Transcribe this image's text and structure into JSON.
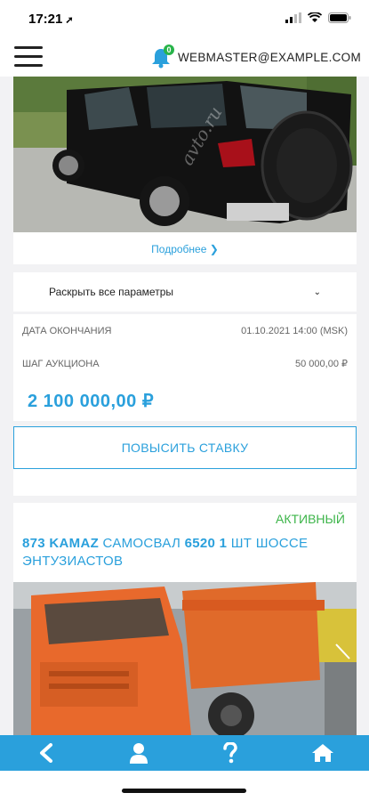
{
  "status_bar": {
    "time": "17:21",
    "location_glyph": "➚"
  },
  "header": {
    "email": "WEBMASTER@EXAMPLE.COM",
    "notification_count": "0"
  },
  "lot1": {
    "more_link": "Подробнее",
    "params_toggle": "Раскрыть все параметры",
    "end_date_label": "ДАТА ОКОНЧАНИЯ",
    "end_date_value": "01.10.2021 14:00 (MSK)",
    "step_label": "ШАГ АУКЦИОНА",
    "step_value": "50 000,00 ₽",
    "price": "2 100 000,00 ₽",
    "raise_button": "ПОВЫСИТЬ СТАВКУ",
    "watermark": "avto.ru"
  },
  "lot2": {
    "status": "АКТИВНЫЙ",
    "title_part1": "873 KAMAZ",
    "title_part2": "САМОСВАЛ",
    "title_part3": "6520 1",
    "title_part4": "ШТ ШОССЕ ЭНТУЗИАСТОВ"
  },
  "colors": {
    "accent": "#2aa0dc",
    "active": "#3db54a",
    "badge": "#28b44a"
  },
  "bottom_nav": [
    "back-icon",
    "user-icon",
    "help-icon",
    "home-icon"
  ]
}
